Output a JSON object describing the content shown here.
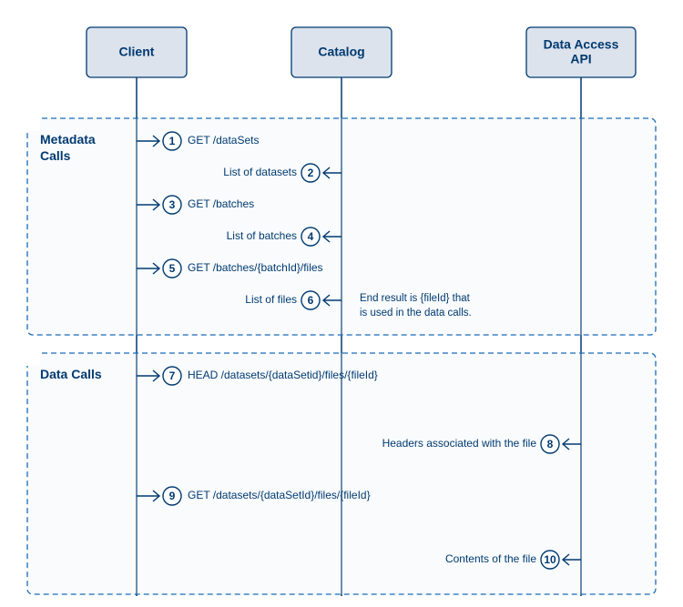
{
  "actors": {
    "client": "Client",
    "catalog": "Catalog",
    "data_api_l1": "Data Access",
    "data_api_l2": "API"
  },
  "groups": {
    "metadata": {
      "title_l1": "Metadata",
      "title_l2": "Calls"
    },
    "data": {
      "title_l1": "Data Calls"
    }
  },
  "steps": {
    "s1": "GET /dataSets",
    "s2": "List of datasets",
    "s3": "GET /batches",
    "s4": "List of batches",
    "s5": "GET /batches/{batchId}/files",
    "s6": "List of files",
    "s7": "HEAD /datasets/{dataSetid}/files/{fileId}",
    "s8": "Headers associated with the file",
    "s9": "GET /datasets/{dataSetId}/files/{fileId}",
    "s10": "Contents of the file"
  },
  "note": {
    "l1": "End result is {fileId} that",
    "l2": "is used in the data calls."
  }
}
